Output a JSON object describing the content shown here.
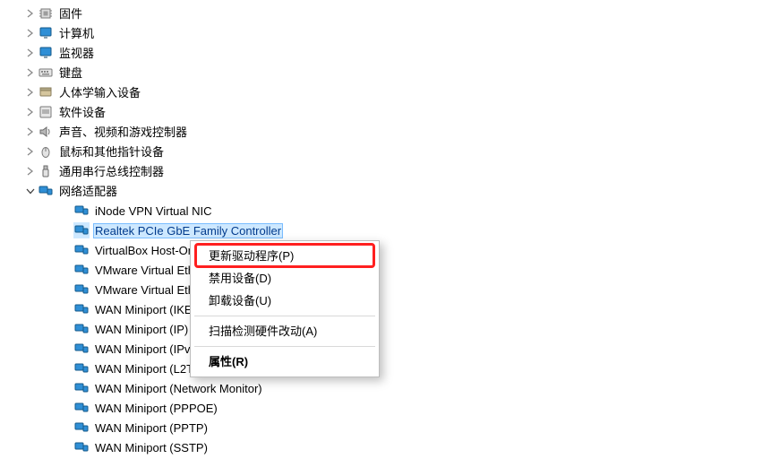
{
  "tree": {
    "categories": [
      {
        "label": "固件",
        "icon": "chip"
      },
      {
        "label": "计算机",
        "icon": "monitor"
      },
      {
        "label": "监视器",
        "icon": "monitor"
      },
      {
        "label": "键盘",
        "icon": "keyboard"
      },
      {
        "label": "人体学输入设备",
        "icon": "hid"
      },
      {
        "label": "软件设备",
        "icon": "sw"
      },
      {
        "label": "声音、视频和游戏控制器",
        "icon": "speaker"
      },
      {
        "label": "鼠标和其他指针设备",
        "icon": "mouse"
      },
      {
        "label": "通用串行总线控制器",
        "icon": "usb"
      }
    ],
    "netCategory": {
      "label": "网络适配器"
    },
    "adapters": [
      {
        "label": "iNode VPN Virtual NIC"
      },
      {
        "label": "Realtek PCIe GbE Family Controller",
        "selected": true
      },
      {
        "label": "VirtualBox Host-On"
      },
      {
        "label": "VMware Virtual Eth"
      },
      {
        "label": "VMware Virtual Eth"
      },
      {
        "label": "WAN Miniport (IKE"
      },
      {
        "label": "WAN Miniport (IP)"
      },
      {
        "label": "WAN Miniport (IPv"
      },
      {
        "label": "WAN Miniport (L2TP)"
      },
      {
        "label": "WAN Miniport (Network Monitor)"
      },
      {
        "label": "WAN Miniport (PPPOE)"
      },
      {
        "label": "WAN Miniport (PPTP)"
      },
      {
        "label": "WAN Miniport (SSTP)"
      }
    ]
  },
  "menu": {
    "update": "更新驱动程序(P)",
    "disable": "禁用设备(D)",
    "uninstall": "卸载设备(U)",
    "scan": "扫描检测硬件改动(A)",
    "properties": "属性(R)"
  }
}
